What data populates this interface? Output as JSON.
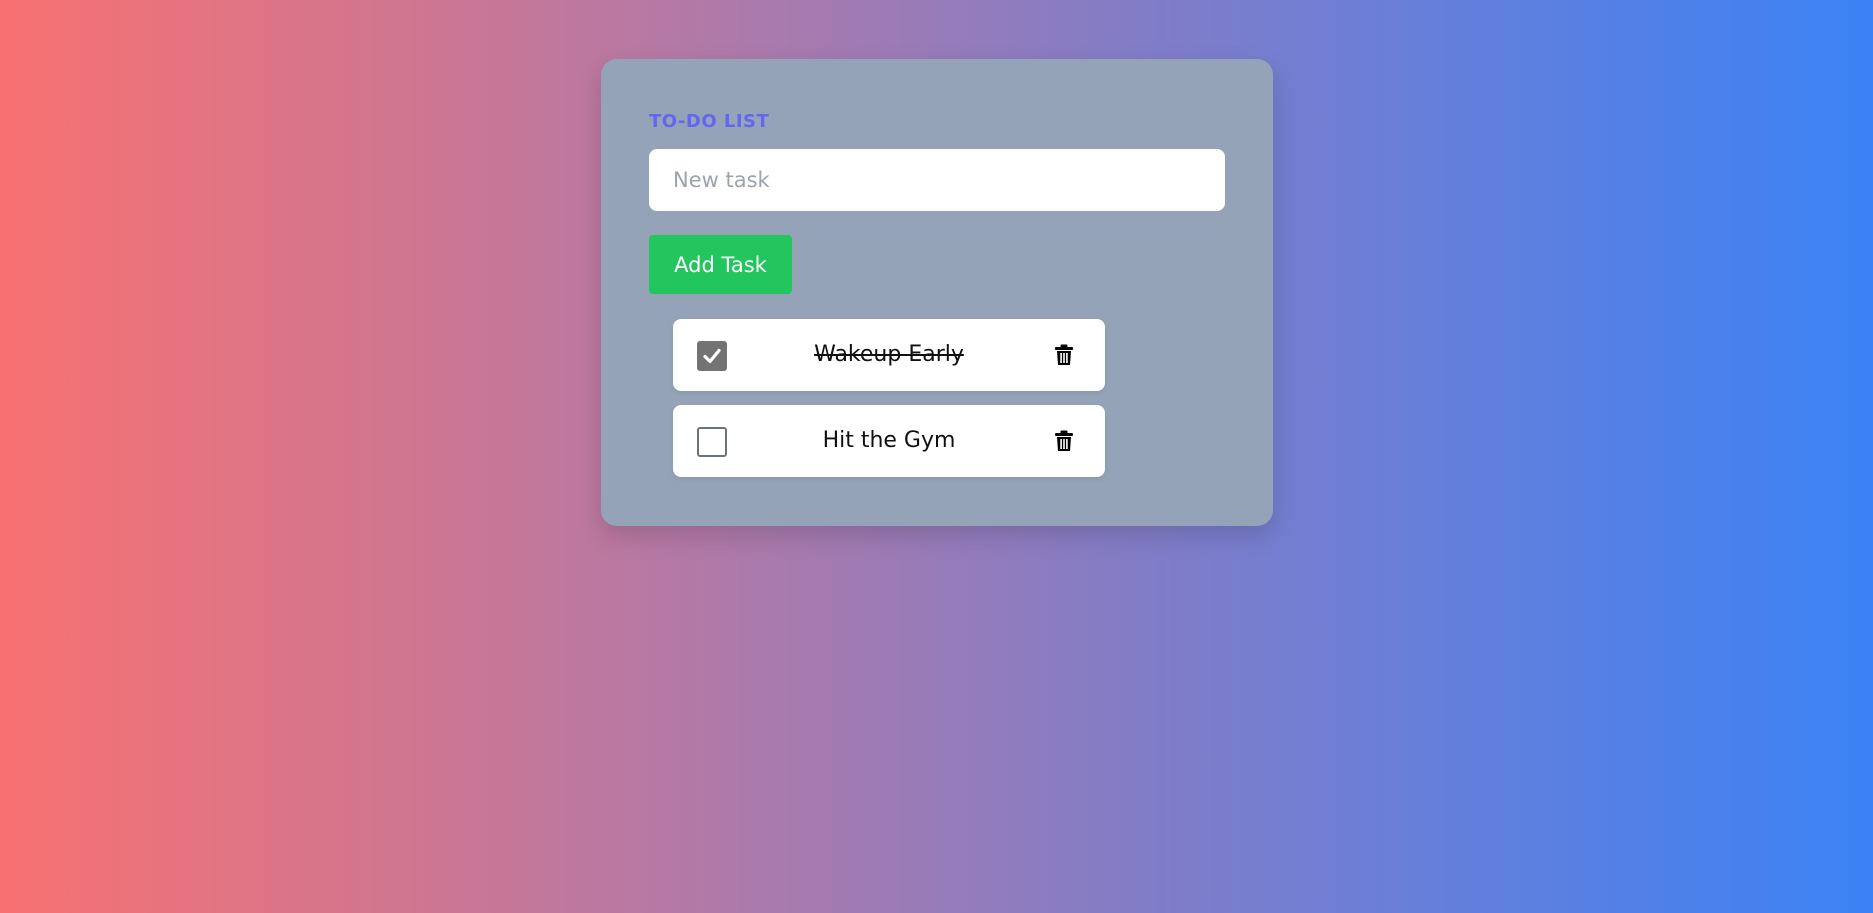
{
  "app": {
    "title": "TO-DO LIST"
  },
  "input": {
    "placeholder": "New task",
    "value": ""
  },
  "add_button": {
    "label": "Add Task",
    "color": "#22c55e"
  },
  "tasks": [
    {
      "label": "Wakeup Early",
      "completed": true,
      "delete_icon": "trash-icon"
    },
    {
      "label": "Hit the Gym",
      "completed": false,
      "delete_icon": "trash-icon"
    }
  ],
  "colors": {
    "title": "#6366f1",
    "card": "#94a3b8",
    "gradient_start": "#f87171",
    "gradient_end": "#3b82f6"
  }
}
